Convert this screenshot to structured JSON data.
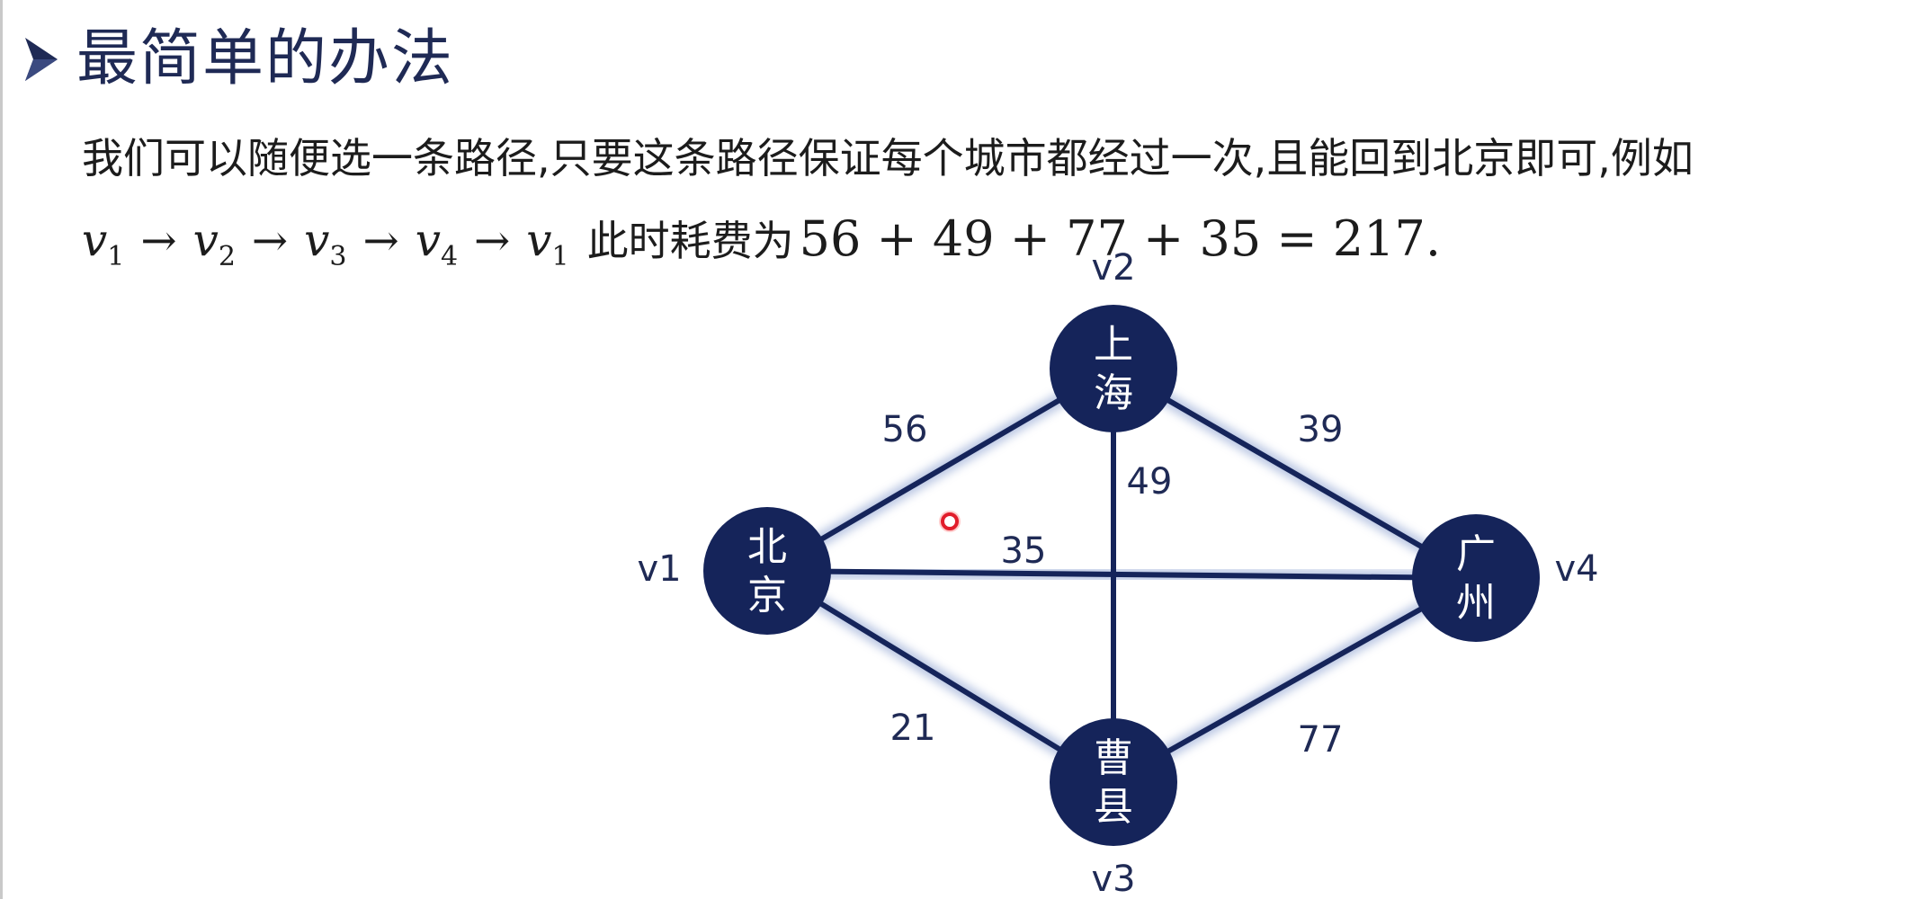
{
  "slide": {
    "title": "最简单的办法",
    "description": "我们可以随便选一条路径,只要这条路径保证每个城市都经过一次,且能回到北京即可,例如",
    "formula": {
      "path": [
        {
          "v": "v",
          "sub": "1"
        },
        {
          "v": "v",
          "sub": "2"
        },
        {
          "v": "v",
          "sub": "3"
        },
        {
          "v": "v",
          "sub": "4"
        },
        {
          "v": "v",
          "sub": "1"
        }
      ],
      "arrow": "→",
      "text": "此时耗费为",
      "expression": "56 + 49 + 77 + 35 = 217."
    }
  },
  "graph": {
    "nodes": [
      {
        "id": "v1",
        "name_line1": "北",
        "name_line2": "京",
        "vlabel": "v1"
      },
      {
        "id": "v2",
        "name_line1": "上",
        "name_line2": "海",
        "vlabel": "v2"
      },
      {
        "id": "v3",
        "name_line1": "曹",
        "name_line2": "县",
        "vlabel": "v3"
      },
      {
        "id": "v4",
        "name_line1": "广",
        "name_line2": "州",
        "vlabel": "v4"
      }
    ],
    "edges": [
      {
        "from": "v1",
        "to": "v2",
        "weight": "56"
      },
      {
        "from": "v2",
        "to": "v4",
        "weight": "39"
      },
      {
        "from": "v2",
        "to": "v3",
        "weight": "49"
      },
      {
        "from": "v1",
        "to": "v4",
        "weight": "35"
      },
      {
        "from": "v1",
        "to": "v3",
        "weight": "21"
      },
      {
        "from": "v3",
        "to": "v4",
        "weight": "77"
      }
    ],
    "colors": {
      "node": "#15245a",
      "edge": "#15245a",
      "glow": "#9fb0d8",
      "pointer": "#e11d2b"
    }
  }
}
